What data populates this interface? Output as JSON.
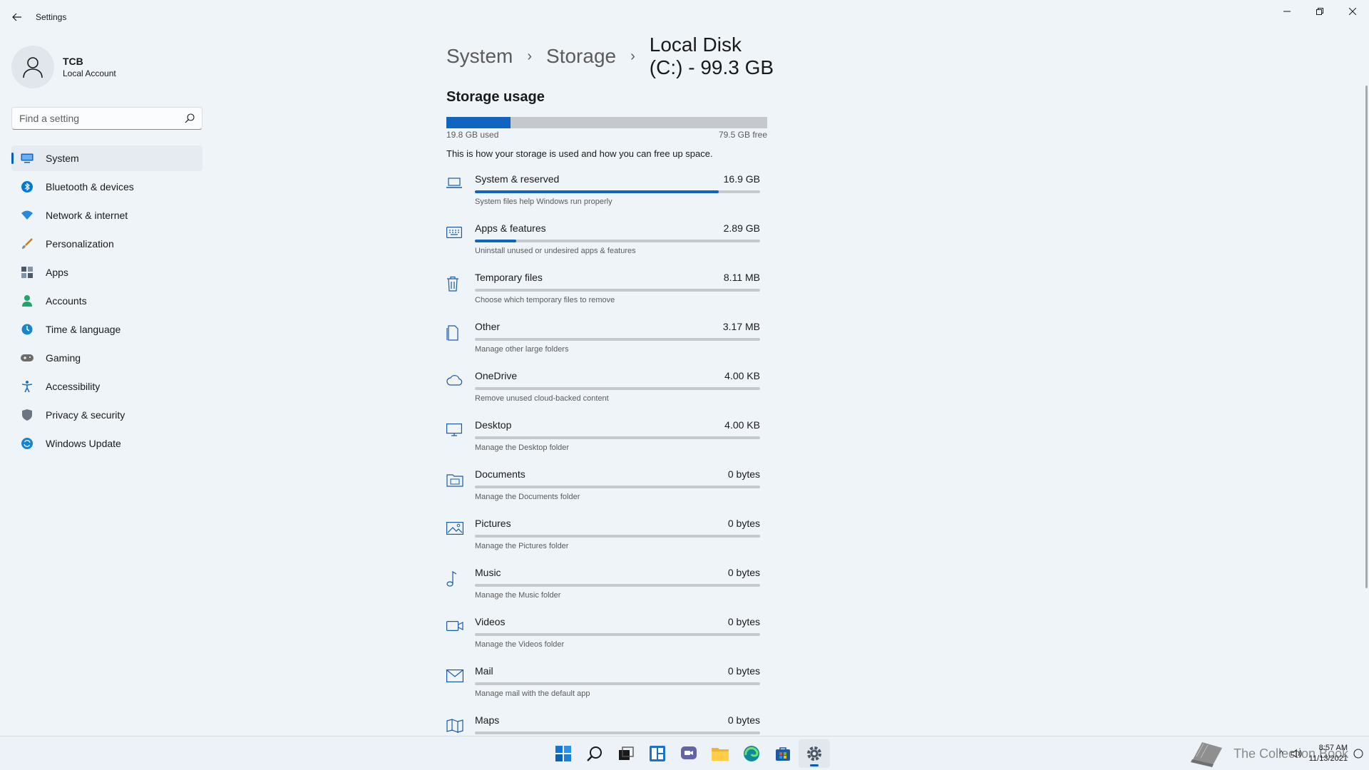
{
  "window": {
    "title": "Settings"
  },
  "profile": {
    "name": "TCB",
    "account_type": "Local Account"
  },
  "search": {
    "placeholder": "Find a setting"
  },
  "nav": [
    {
      "label": "System",
      "icon": "monitor-icon",
      "color": "#0f65bf",
      "active": true
    },
    {
      "label": "Bluetooth & devices",
      "icon": "bluetooth-icon",
      "color": "#0078d4"
    },
    {
      "label": "Network & internet",
      "icon": "wifi-icon",
      "color": "#2b88d8"
    },
    {
      "label": "Personalization",
      "icon": "brush-icon",
      "color": "#c77b2c"
    },
    {
      "label": "Apps",
      "icon": "apps-icon",
      "color": "#4a5a6b"
    },
    {
      "label": "Accounts",
      "icon": "person-icon",
      "color": "#1fa56b"
    },
    {
      "label": "Time & language",
      "icon": "globe-clock-icon",
      "color": "#1787c9"
    },
    {
      "label": "Gaming",
      "icon": "gamepad-icon",
      "color": "#6b6b6b"
    },
    {
      "label": "Accessibility",
      "icon": "accessibility-icon",
      "color": "#1a6fc4"
    },
    {
      "label": "Privacy & security",
      "icon": "shield-icon",
      "color": "#6b7580"
    },
    {
      "label": "Windows Update",
      "icon": "update-icon",
      "color": "#1684d4"
    }
  ],
  "breadcrumb": {
    "items": [
      "System",
      "Storage"
    ],
    "current": "Local Disk (C:) - 99.3 GB"
  },
  "storage": {
    "section_title": "Storage usage",
    "used_label": "19.8 GB used",
    "free_label": "79.5 GB free",
    "used_fraction": 0.199,
    "description": "This is how your storage is used and how you can free up space."
  },
  "categories": [
    {
      "name": "System & reserved",
      "size": "16.9 GB",
      "desc": "System files help Windows run properly",
      "fraction": 0.855,
      "icon": "laptop-icon"
    },
    {
      "name": "Apps & features",
      "size": "2.89 GB",
      "desc": "Uninstall unused or undesired apps & features",
      "fraction": 0.146,
      "icon": "keyboard-icon"
    },
    {
      "name": "Temporary files",
      "size": "8.11 MB",
      "desc": "Choose which temporary files to remove",
      "fraction": 0,
      "icon": "trash-icon"
    },
    {
      "name": "Other",
      "size": "3.17 MB",
      "desc": "Manage other large folders",
      "fraction": 0,
      "icon": "document-icon"
    },
    {
      "name": "OneDrive",
      "size": "4.00 KB",
      "desc": "Remove unused cloud-backed content",
      "fraction": 0,
      "icon": "cloud-icon"
    },
    {
      "name": "Desktop",
      "size": "4.00 KB",
      "desc": "Manage the Desktop folder",
      "fraction": 0,
      "icon": "desktop-icon"
    },
    {
      "name": "Documents",
      "size": "0 bytes",
      "desc": "Manage the Documents folder",
      "fraction": 0,
      "icon": "folder-documents-icon"
    },
    {
      "name": "Pictures",
      "size": "0 bytes",
      "desc": "Manage the Pictures folder",
      "fraction": 0,
      "icon": "picture-icon"
    },
    {
      "name": "Music",
      "size": "0 bytes",
      "desc": "Manage the Music folder",
      "fraction": 0,
      "icon": "music-note-icon"
    },
    {
      "name": "Videos",
      "size": "0 bytes",
      "desc": "Manage the Videos folder",
      "fraction": 0,
      "icon": "video-icon"
    },
    {
      "name": "Mail",
      "size": "0 bytes",
      "desc": "Manage mail with the default app",
      "fraction": 0,
      "icon": "mail-icon"
    },
    {
      "name": "Maps",
      "size": "0 bytes",
      "desc": "",
      "fraction": 0,
      "icon": "map-icon"
    }
  ],
  "taskbar": {
    "apps": [
      "windows-start-icon",
      "search-icon",
      "task-view-icon",
      "widgets-icon",
      "chat-icon",
      "file-explorer-icon",
      "edge-icon",
      "store-icon",
      "settings-icon"
    ],
    "watermark": "The Collection Book",
    "time": "8:57 AM",
    "date": "11/13/2021"
  },
  "colors": {
    "accent": "#005fb8",
    "bar_fill": "#0f65bf",
    "bar_track": "#c5c9ce",
    "background": "#eff4f9"
  }
}
